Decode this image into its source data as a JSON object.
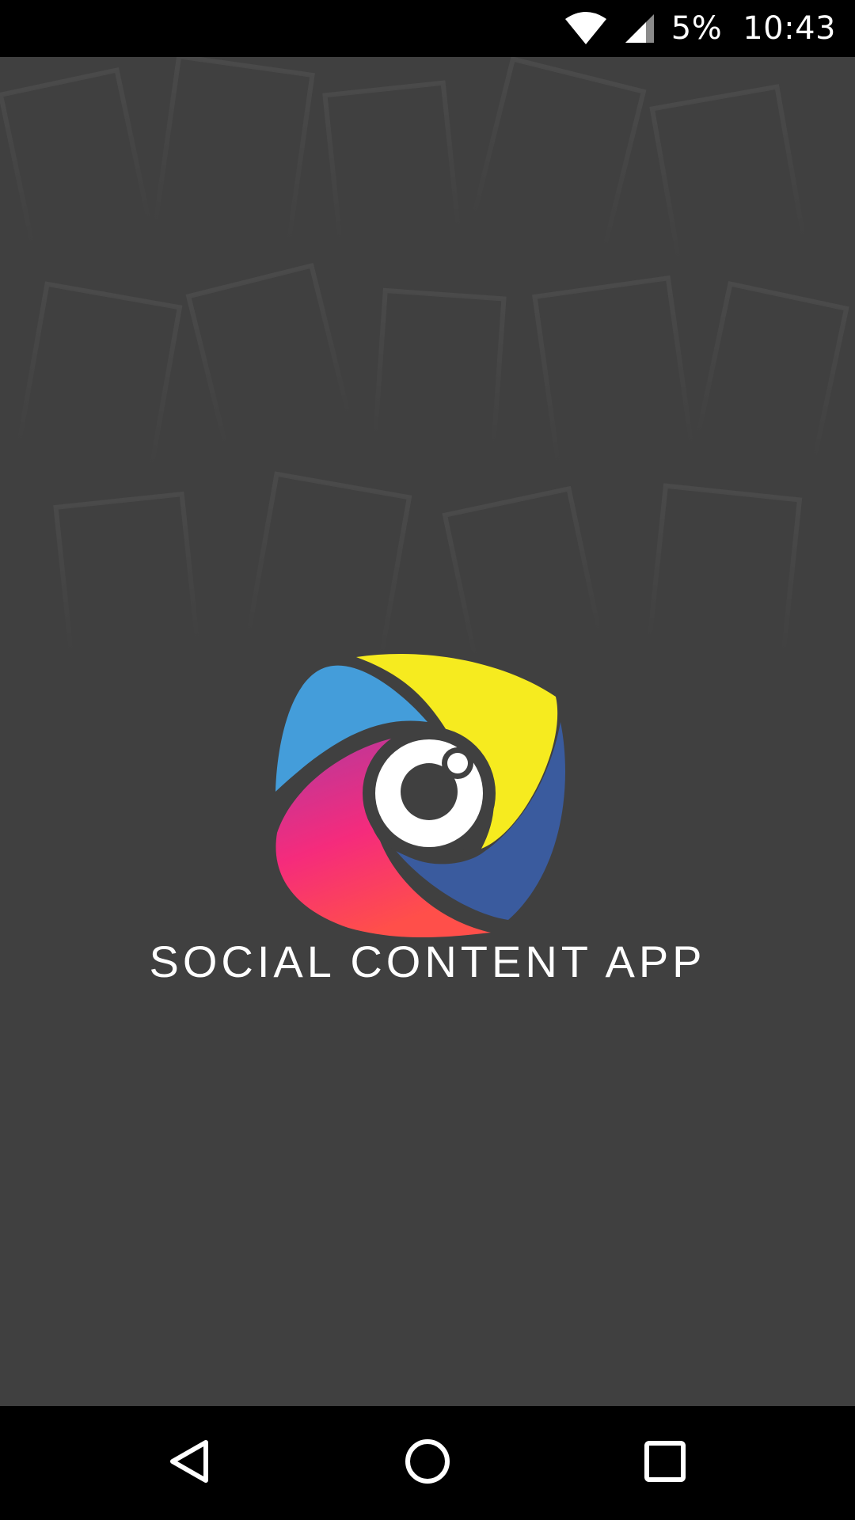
{
  "status_bar": {
    "battery": "5%",
    "time": "10:43",
    "icons": [
      "wifi-icon",
      "cell-signal-icon"
    ]
  },
  "app": {
    "title": "SOCIAL CONTENT APP"
  },
  "logo": {
    "colors": {
      "light_blue": "#449DDA",
      "yellow": "#F6EB1F",
      "dark_blue": "#3A5B9E",
      "magenta": "#B23A9E",
      "pink": "#F52B7C",
      "coral": "#FF4F4A"
    }
  },
  "nav_bar": {
    "icons": [
      "back-icon",
      "home-icon",
      "recents-icon"
    ]
  },
  "colors": {
    "background": "#404040",
    "bars": "#000000",
    "text": "#FFFFFF"
  }
}
